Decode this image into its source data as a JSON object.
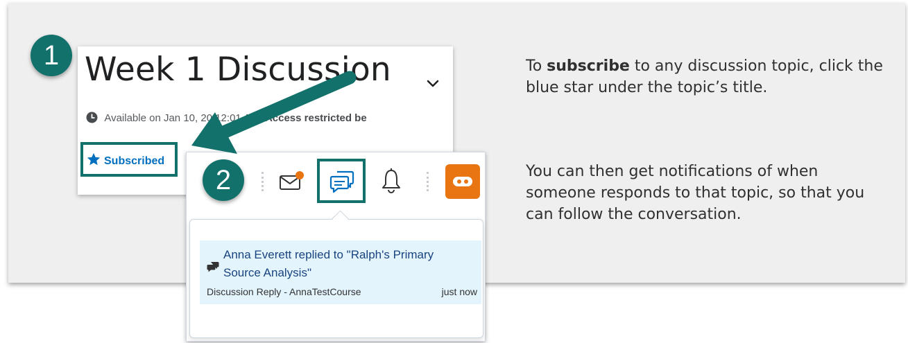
{
  "screenshot1": {
    "title": "Week 1 Discussion",
    "availability_prefix": "Available on Jan 1",
    "availability_obscured": "0, 20",
    "availability_time": "12:01 AM.",
    "availability_restricted": "Access restricted be",
    "subscribed_label": "Subscribed",
    "chevron_icon": "chevron-down-icon",
    "clock_icon": "clock-icon",
    "star_icon": "star-icon",
    "star_color": "#006fbf"
  },
  "screenshot2": {
    "navbar_icons": [
      "mail-icon",
      "chat-bubbles-icon",
      "bell-icon",
      "orange-course-icon"
    ],
    "notification": {
      "title": "Anna Everett replied to \"Ralph's Primary Source Analysis\"",
      "source": "Discussion Reply - AnnaTestCourse",
      "time": "just now"
    }
  },
  "steps": {
    "step1": "1",
    "step2": "2"
  },
  "instructions": {
    "para1_prefix": "To ",
    "para1_bold": "subscribe",
    "para1_suffix": " to any discussion topic, click the blue star under the topic’s title.",
    "para2": "You can then get notifications of when someone responds to that topic, so that you can follow the conversation."
  },
  "colors": {
    "highlight_teal": "#12716b",
    "link_blue": "#006fbf",
    "notification_bg": "#e3f4fd",
    "orange": "#e87511",
    "badge_dot": "#e87511"
  }
}
